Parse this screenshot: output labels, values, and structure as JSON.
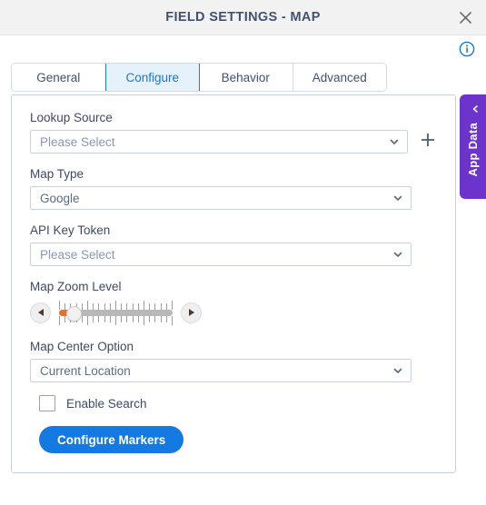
{
  "window": {
    "title": "FIELD SETTINGS - MAP",
    "close_icon": "close-icon",
    "info_icon": "info-circle-icon"
  },
  "tabs": [
    {
      "label": "General",
      "active": false
    },
    {
      "label": "Configure",
      "active": true
    },
    {
      "label": "Behavior",
      "active": false
    },
    {
      "label": "Advanced",
      "active": false
    }
  ],
  "form": {
    "lookup_source": {
      "label": "Lookup Source",
      "value": "Please Select",
      "placeholder": "Please Select",
      "is_placeholder": true,
      "add_icon": "plus-icon"
    },
    "map_type": {
      "label": "Map Type",
      "value": "Google",
      "is_placeholder": false
    },
    "api_key_token": {
      "label": "API Key Token",
      "value": "Please Select",
      "placeholder": "Please Select",
      "is_placeholder": true
    },
    "map_zoom_level": {
      "label": "Map Zoom Level",
      "value": 1,
      "min": 0,
      "max": 20,
      "decrement_icon": "triangle-left-icon",
      "increment_icon": "triangle-right-icon"
    },
    "map_center_option": {
      "label": "Map Center Option",
      "value": "Current Location",
      "is_placeholder": false
    },
    "enable_search": {
      "label": "Enable Search",
      "checked": false
    },
    "configure_markers_button": {
      "label": "Configure Markers"
    }
  },
  "side_panel": {
    "label": "App Data",
    "collapse_icon": "chevron-left-icon"
  },
  "colors": {
    "accent_blue": "#1479e0",
    "active_tab_border": "#1a7fd4",
    "active_tab_bg": "#e6f2fb",
    "purple": "#6c34cc",
    "slider_fill": "#e8702a",
    "title_text": "#42526e"
  }
}
